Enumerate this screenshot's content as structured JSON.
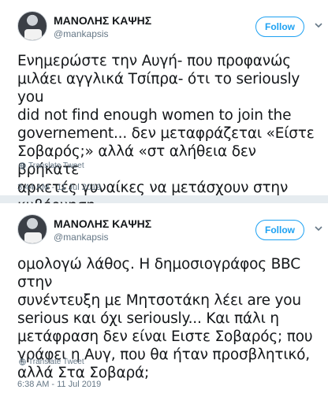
{
  "tweets": [
    {
      "name": "ΜΑΝΟΛΗΣ ΚΑΨΗΣ",
      "handle": "@mankapsis",
      "follow_label": "Follow",
      "lines": [
        "Ενημερώστε την Αυγή- που προφανώς",
        "μιλάει αγγλικά Τσίπρα- ότι το seriously you",
        "did not find enough women to join the",
        "governement... δεν μεταφράζεται «Είστε",
        "Σοβαρός;» αλλά «στ αλήθεια δεν βρήκατε",
        "αρκετές γυναίκες να μετάσχουν στην",
        "κυβέρνηση"
      ],
      "translate_label": "Translate Tweet",
      "timestamp": "3:44 AM - 11 Jul 2019"
    },
    {
      "name": "ΜΑΝΟΛΗΣ ΚΑΨΗΣ",
      "handle": "@mankapsis",
      "follow_label": "Follow",
      "lines": [
        "ομολογώ λάθος. Η δημοσιογράφος BBC στην",
        "συνέντευξη με Μητσοτάκη λέει are you",
        "serious και όχι seriously... Και πάλι η",
        "μετάφραση δεν είναι Ειστε Σοβαρός; που",
        "γράφει η Αυγ, που θα ήταν προσβλητικό,",
        "αλλά Στα Σοβαρά;"
      ],
      "translate_label": "Translate Tweet",
      "timestamp": "6:38 AM - 11 Jul 2019"
    }
  ],
  "colors": {
    "accent": "#1da1f2",
    "muted": "#657786",
    "background": "#e6ecf0"
  },
  "icons": {
    "more": "chevron-down-icon",
    "translate": "globe-icon"
  }
}
